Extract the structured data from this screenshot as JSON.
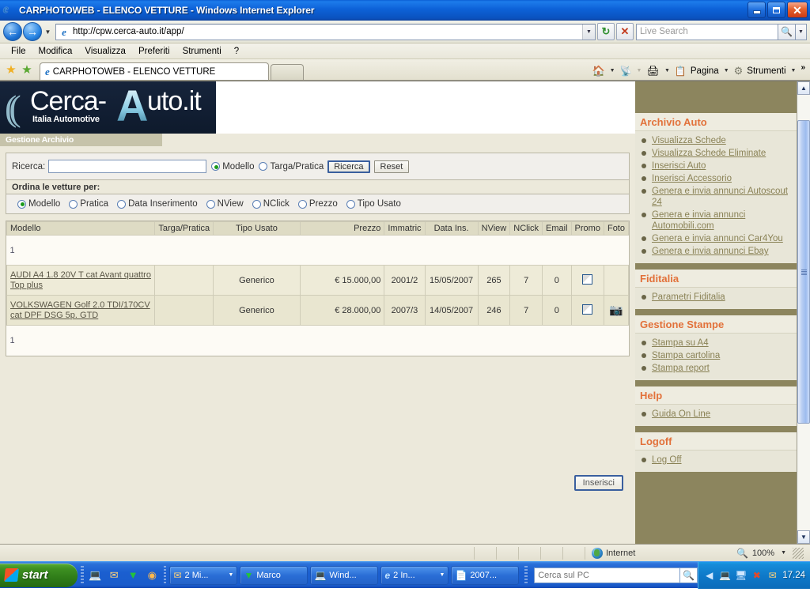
{
  "window": {
    "title": "CARPHOTOWEB - ELENCO VETTURE - Windows Internet Explorer",
    "minimize_label": "Riduci a icona",
    "maximize_label": "Ingrandisci",
    "close_label": "Chiudi"
  },
  "browser": {
    "url": "http://cpw.cerca-auto.it/app/",
    "search_placeholder": "Live Search",
    "menu": [
      "File",
      "Modifica",
      "Visualizza",
      "Preferiti",
      "Strumenti",
      "?"
    ],
    "tab_title": "CARPHOTOWEB - ELENCO VETTURE",
    "toolbar": {
      "page_label": "Pagina",
      "tools_label": "Strumenti",
      "overflow": "»"
    }
  },
  "site": {
    "logo_arcs": "((",
    "logo_brand": "Cerca-",
    "logo_bigA": "A",
    "logo_brand_tail": "uto.it",
    "logo_tagline": "Italia Automotive",
    "section_title": "Gestione Archivio"
  },
  "search_panel": {
    "label": "Ricerca:",
    "value": "",
    "mode_options": [
      {
        "label": "Modello",
        "selected": true
      },
      {
        "label": "Targa/Pratica",
        "selected": false
      }
    ],
    "search_button": "Ricerca",
    "reset_button": "Reset",
    "order_label": "Ordina le vetture per:",
    "order_options": [
      {
        "label": "Modello",
        "selected": true
      },
      {
        "label": "Pratica",
        "selected": false
      },
      {
        "label": "Data Inserimento",
        "selected": false
      },
      {
        "label": "NView",
        "selected": false
      },
      {
        "label": "NClick",
        "selected": false
      },
      {
        "label": "Prezzo",
        "selected": false
      },
      {
        "label": "Tipo Usato",
        "selected": false
      }
    ]
  },
  "table": {
    "page_top": "1",
    "page_bottom": "1",
    "headers": [
      "Modello",
      "Targa/Pratica",
      "Tipo Usato",
      "Prezzo",
      "Immatric",
      "Data Ins.",
      "NView",
      "NClick",
      "Email",
      "Promo",
      "Foto"
    ],
    "rows": [
      {
        "modello": "AUDI A4 1.8 20V T cat Avant quattro Top plus",
        "targa": "",
        "tipo_usato": "Generico",
        "prezzo": "€ 15.000,00",
        "immatric": "2001/2",
        "data_ins": "15/05/2007",
        "nview": "265",
        "nclick": "7",
        "email": "0",
        "promo_checked": false,
        "foto": false
      },
      {
        "modello": "VOLKSWAGEN Golf 2.0 TDI/170CV cat DPF DSG 5p. GTD",
        "targa": "",
        "tipo_usato": "Generico",
        "prezzo": "€ 28.000,00",
        "immatric": "2007/3",
        "data_ins": "14/05/2007",
        "nview": "246",
        "nclick": "7",
        "email": "0",
        "promo_checked": false,
        "foto": true
      }
    ],
    "insert_button": "Inserisci"
  },
  "sidebar": {
    "sections": [
      {
        "title": "Archivio Auto",
        "links": [
          "Visualizza Schede",
          "Visualizza Schede Eliminate",
          "Inserisci Auto",
          "Inserisci Accessorio",
          "Genera e invia annunci Autoscout 24",
          "Genera e invia annunci Automobili.com",
          "Genera e invia annunci Car4You",
          "Genera e invia annunci Ebay"
        ]
      },
      {
        "title": "Fiditalia",
        "links": [
          "Parametri Fiditalia"
        ]
      },
      {
        "title": "Gestione Stampe",
        "links": [
          "Stampa su A4",
          "Stampa cartolina",
          "Stampa report"
        ]
      },
      {
        "title": "Help",
        "links": [
          "Guida On Line"
        ]
      },
      {
        "title": "Logoff",
        "links": [
          "Log Off"
        ]
      }
    ]
  },
  "statusbar": {
    "zone": "Internet",
    "zoom": "100%"
  },
  "taskbar": {
    "start": "start",
    "buttons": [
      {
        "label": "2 Mi...",
        "has_caret": true,
        "icon": "outlook-icon"
      },
      {
        "label": "Marco",
        "has_caret": false,
        "icon": "folder-green-icon"
      },
      {
        "label": "Wind...",
        "has_caret": false,
        "icon": "window-icon"
      },
      {
        "label": "2 In...",
        "has_caret": true,
        "icon": "ie-icon"
      },
      {
        "label": "2007...",
        "has_caret": false,
        "icon": "word-icon"
      }
    ],
    "search_placeholder": "Cerca sul PC",
    "clock": "17.24"
  },
  "colors": {
    "accent_orange": "#e2713a",
    "sidebar_bg": "#8c855e",
    "panel_bg": "#ece9db",
    "link": "#8a8256",
    "title_blue": "#0d62d8"
  }
}
